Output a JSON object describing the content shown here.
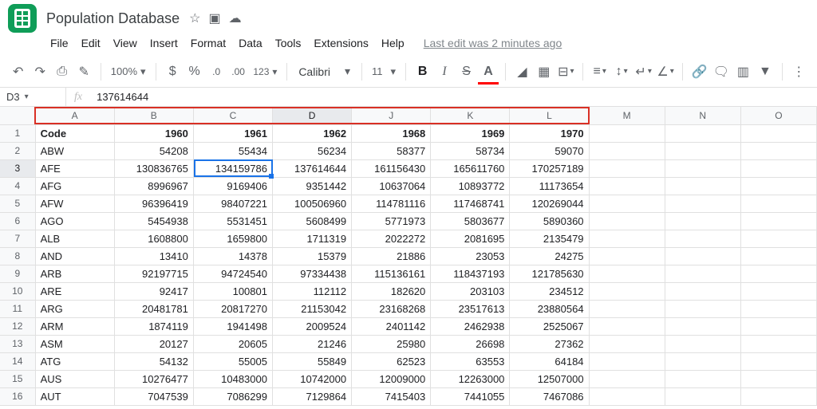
{
  "document": {
    "title": "Population Database",
    "last_edit": "Last edit was 2 minutes ago"
  },
  "menus": {
    "file": "File",
    "edit": "Edit",
    "view": "View",
    "insert": "Insert",
    "format": "Format",
    "data": "Data",
    "tools": "Tools",
    "extensions": "Extensions",
    "help": "Help"
  },
  "toolbar": {
    "zoom": "100%",
    "dollar": "$",
    "percent": "%",
    "dec_dec": ".0",
    "dec_inc": ".00",
    "more_formats": "123",
    "font": "Calibri",
    "size": "11"
  },
  "namebox": "D3",
  "formula": "137614644",
  "columns": [
    "A",
    "B",
    "C",
    "D",
    "J",
    "K",
    "L",
    "M",
    "N",
    "O"
  ],
  "header_row": [
    "Code",
    "1960",
    "1961",
    "1962",
    "1968",
    "1969",
    "1970",
    "",
    "",
    ""
  ],
  "rows": [
    {
      "n": "2",
      "cells": [
        "ABW",
        "54208",
        "55434",
        "56234",
        "58377",
        "58734",
        "59070",
        "",
        "",
        ""
      ]
    },
    {
      "n": "3",
      "cells": [
        "AFE",
        "130836765",
        "134159786",
        "137614644",
        "161156430",
        "165611760",
        "170257189",
        "",
        "",
        ""
      ]
    },
    {
      "n": "4",
      "cells": [
        "AFG",
        "8996967",
        "9169406",
        "9351442",
        "10637064",
        "10893772",
        "11173654",
        "",
        "",
        ""
      ]
    },
    {
      "n": "5",
      "cells": [
        "AFW",
        "96396419",
        "98407221",
        "100506960",
        "114781116",
        "117468741",
        "120269044",
        "",
        "",
        ""
      ]
    },
    {
      "n": "6",
      "cells": [
        "AGO",
        "5454938",
        "5531451",
        "5608499",
        "5771973",
        "5803677",
        "5890360",
        "",
        "",
        ""
      ]
    },
    {
      "n": "7",
      "cells": [
        "ALB",
        "1608800",
        "1659800",
        "1711319",
        "2022272",
        "2081695",
        "2135479",
        "",
        "",
        ""
      ]
    },
    {
      "n": "8",
      "cells": [
        "AND",
        "13410",
        "14378",
        "15379",
        "21886",
        "23053",
        "24275",
        "",
        "",
        ""
      ]
    },
    {
      "n": "9",
      "cells": [
        "ARB",
        "92197715",
        "94724540",
        "97334438",
        "115136161",
        "118437193",
        "121785630",
        "",
        "",
        ""
      ]
    },
    {
      "n": "10",
      "cells": [
        "ARE",
        "92417",
        "100801",
        "112112",
        "182620",
        "203103",
        "234512",
        "",
        "",
        ""
      ]
    },
    {
      "n": "11",
      "cells": [
        "ARG",
        "20481781",
        "20817270",
        "21153042",
        "23168268",
        "23517613",
        "23880564",
        "",
        "",
        ""
      ]
    },
    {
      "n": "12",
      "cells": [
        "ARM",
        "1874119",
        "1941498",
        "2009524",
        "2401142",
        "2462938",
        "2525067",
        "",
        "",
        ""
      ]
    },
    {
      "n": "13",
      "cells": [
        "ASM",
        "20127",
        "20605",
        "21246",
        "25980",
        "26698",
        "27362",
        "",
        "",
        ""
      ]
    },
    {
      "n": "14",
      "cells": [
        "ATG",
        "54132",
        "55005",
        "55849",
        "62523",
        "63553",
        "64184",
        "",
        "",
        ""
      ]
    },
    {
      "n": "15",
      "cells": [
        "AUS",
        "10276477",
        "10483000",
        "10742000",
        "12009000",
        "12263000",
        "12507000",
        "",
        "",
        ""
      ]
    },
    {
      "n": "16",
      "cells": [
        "AUT",
        "7047539",
        "7086299",
        "7129864",
        "7415403",
        "7441055",
        "7467086",
        "",
        "",
        ""
      ]
    }
  ],
  "icons": {
    "star": "☆",
    "move": "▣",
    "cloud": "☁",
    "caret": "▾",
    "undo": "↶",
    "redo": "↷",
    "print": "⎙",
    "paint": "✎",
    "bold": "B",
    "italic": "I",
    "strike": "S",
    "textcolor": "A",
    "fill": "◢",
    "borders": "▦",
    "merge": "⊟",
    "halign": "≡",
    "valign": "↕",
    "wrap": "↵",
    "rotate": "∠",
    "link": "🔗",
    "comment": "🗨",
    "chart": "▥",
    "filter": "▼",
    "more": "⋮"
  }
}
